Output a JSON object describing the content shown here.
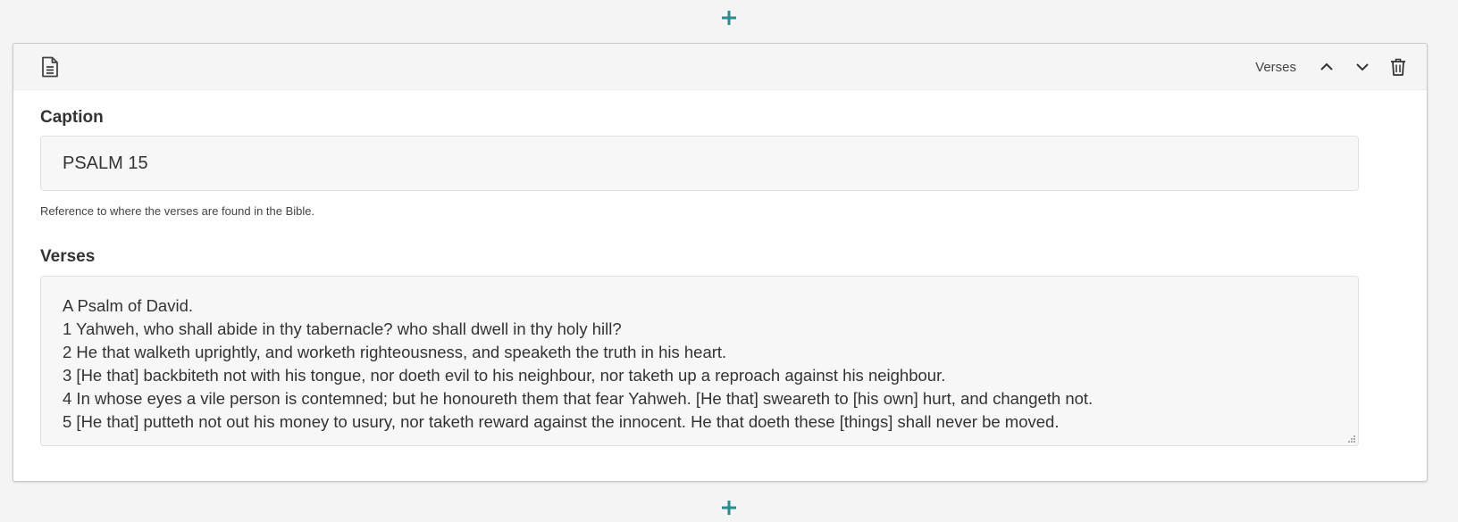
{
  "add_top": {
    "icon": "plus-icon",
    "color": "#2d8a8f"
  },
  "block": {
    "header": {
      "icon": "document-icon",
      "type_label": "Verses",
      "move_up_icon": "chevron-up-icon",
      "move_down_icon": "chevron-down-icon",
      "delete_icon": "trash-icon"
    },
    "caption": {
      "label": "Caption",
      "value": "PSALM 15",
      "help": "Reference to where the verses are found in the Bible."
    },
    "verses": {
      "label": "Verses",
      "lines": [
        "A Psalm of David.",
        "1 Yahweh, who shall abide in thy tabernacle? who shall dwell in thy holy hill?",
        "2 He that walketh uprightly, and worketh righteousness, and speaketh the truth in his heart.",
        "3 [He that] backbiteth not with his tongue, nor doeth evil to his neighbour, nor taketh up a reproach against his neighbour.",
        "4 In whose eyes a vile person is contemned; but he honoureth them that fear Yahweh. [He that] sweareth to [his own] hurt, and changeth not.",
        "5 [He that] putteth not out his money to usury, nor taketh reward against the innocent. He that doeth these [things] shall never be moved."
      ]
    }
  },
  "add_bottom": {
    "icon": "plus-icon",
    "color": "#2d8a8f"
  }
}
